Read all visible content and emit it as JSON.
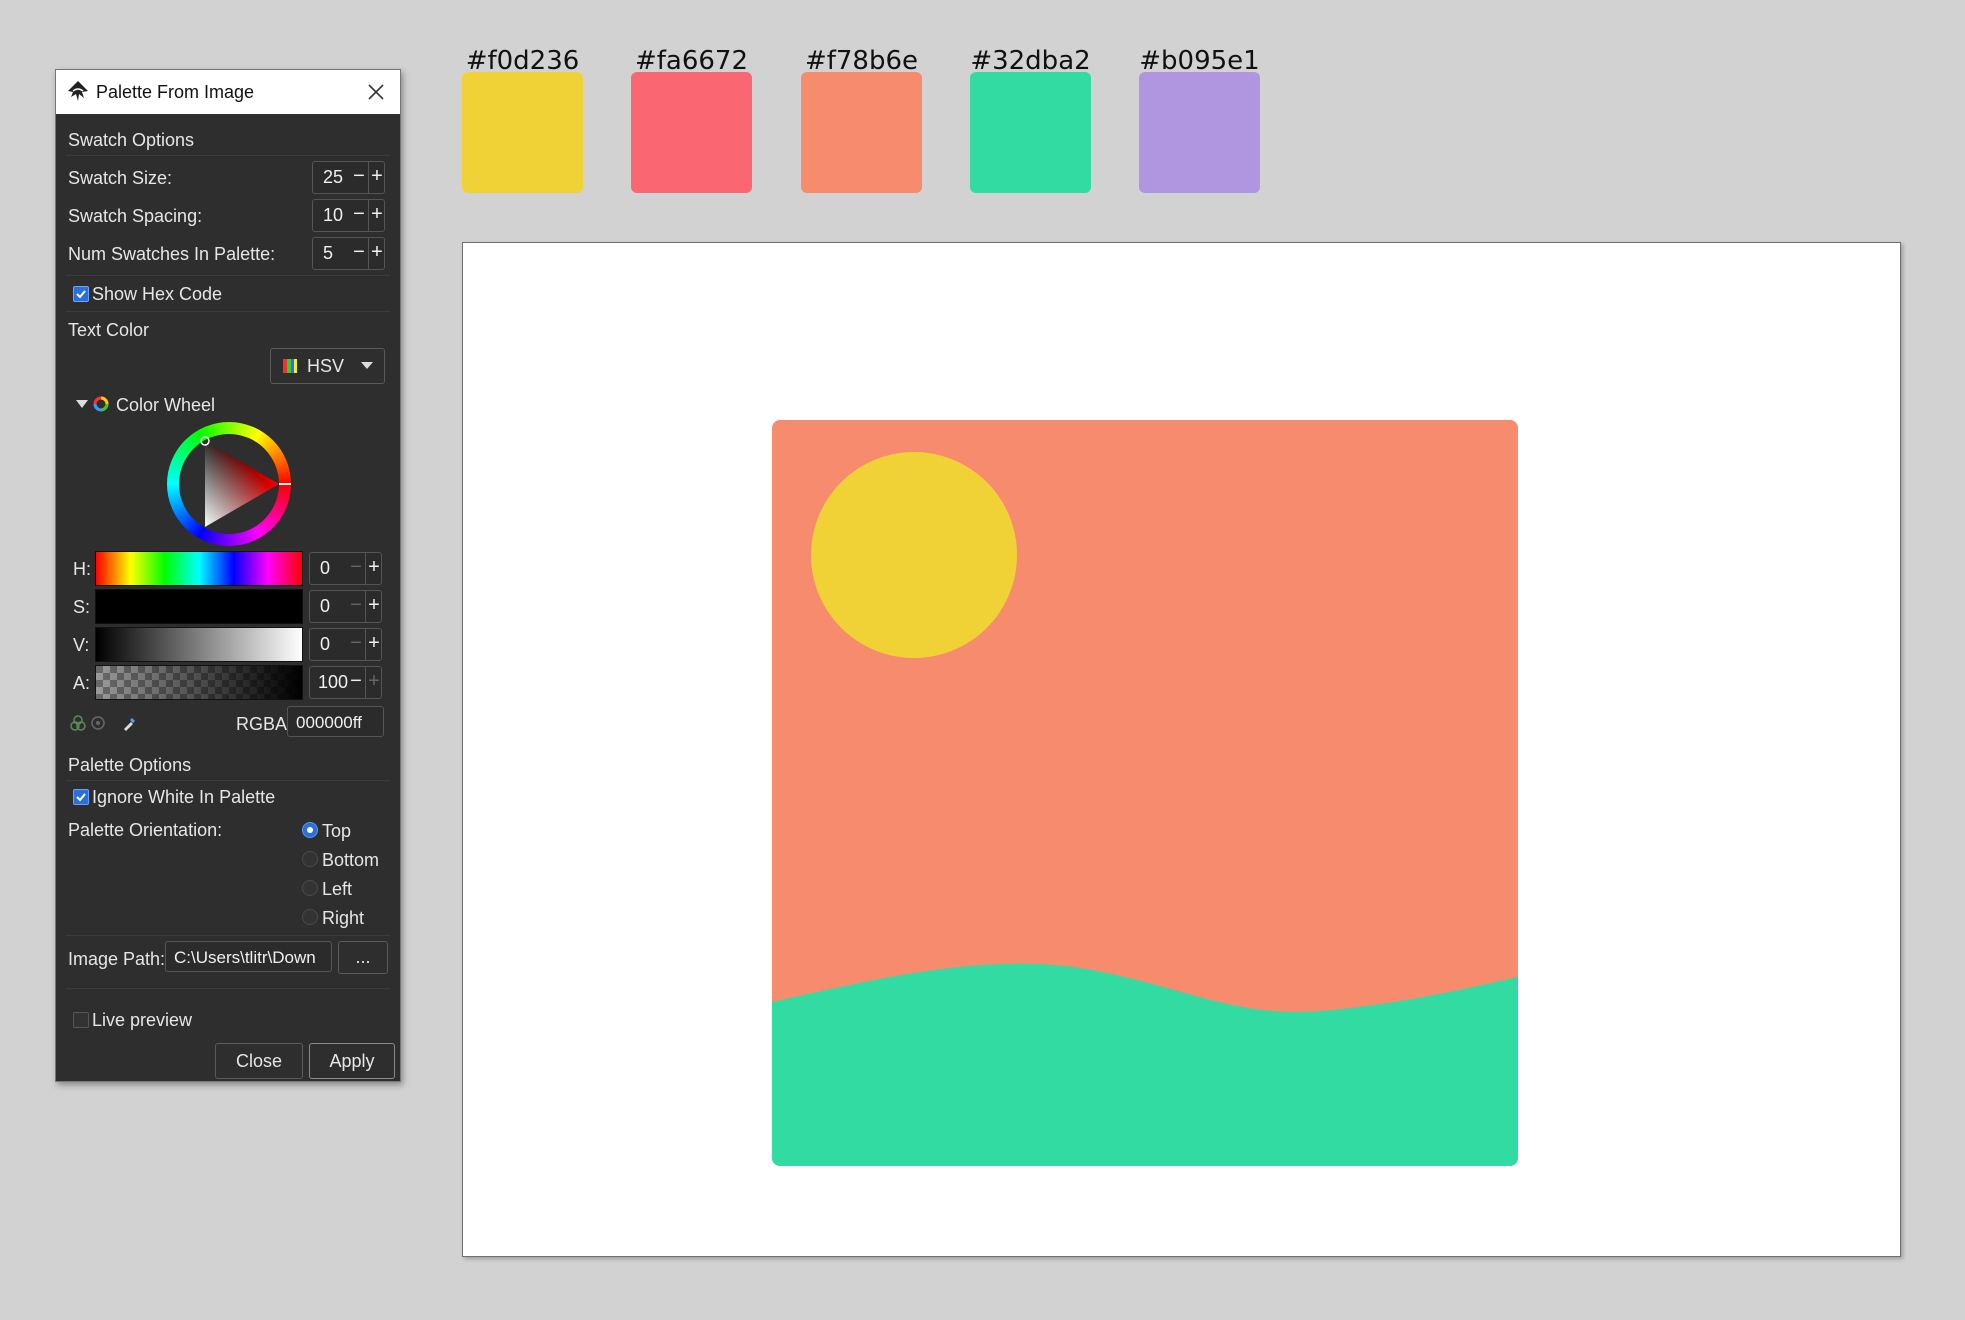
{
  "palette": {
    "swatches": [
      {
        "hex": "#f0d236",
        "color": "#f0d236"
      },
      {
        "hex": "#fa6672",
        "color": "#fa6672"
      },
      {
        "hex": "#f78b6e",
        "color": "#f78b6e"
      },
      {
        "hex": "#32dba2",
        "color": "#32dba2"
      },
      {
        "hex": "#b095e1",
        "color": "#b095e1"
      }
    ]
  },
  "dialog": {
    "title": "Palette From Image",
    "swatch_options": {
      "heading": "Swatch Options",
      "swatch_size_label": "Swatch Size:",
      "swatch_size_value": "25",
      "swatch_spacing_label": "Swatch Spacing:",
      "swatch_spacing_value": "10",
      "num_swatches_label": "Num Swatches In Palette:",
      "num_swatches_value": "5",
      "show_hex_label": "Show Hex Code",
      "show_hex_checked": true
    },
    "text_color": {
      "heading": "Text Color",
      "mode": "HSV",
      "wheel_label": "Color Wheel",
      "h_label": "H:",
      "h_value": "0",
      "s_label": "S:",
      "s_value": "0",
      "v_label": "V:",
      "v_value": "0",
      "a_label": "A:",
      "a_value": "100",
      "rgba_label": "RGBA:",
      "rgba_value": "000000ff"
    },
    "palette_options": {
      "heading": "Palette Options",
      "ignore_white_label": "Ignore White In Palette",
      "ignore_white_checked": true,
      "orientation_label": "Palette Orientation:",
      "orientations": [
        "Top",
        "Bottom",
        "Left",
        "Right"
      ],
      "selected_orientation": "Top"
    },
    "image_path_label": "Image Path:",
    "image_path_value": "C:\\Users\\tlitr\\Down",
    "browse_label": "...",
    "live_preview_label": "Live preview",
    "live_preview_checked": false,
    "close_label": "Close",
    "apply_label": "Apply"
  },
  "colors": {
    "artwork_background": "#f78b6e",
    "sun": "#f0d236",
    "hills": "#32dba2",
    "dialog_bg": "#2e2e2e",
    "checkbox_accent": "#2a70d8"
  }
}
